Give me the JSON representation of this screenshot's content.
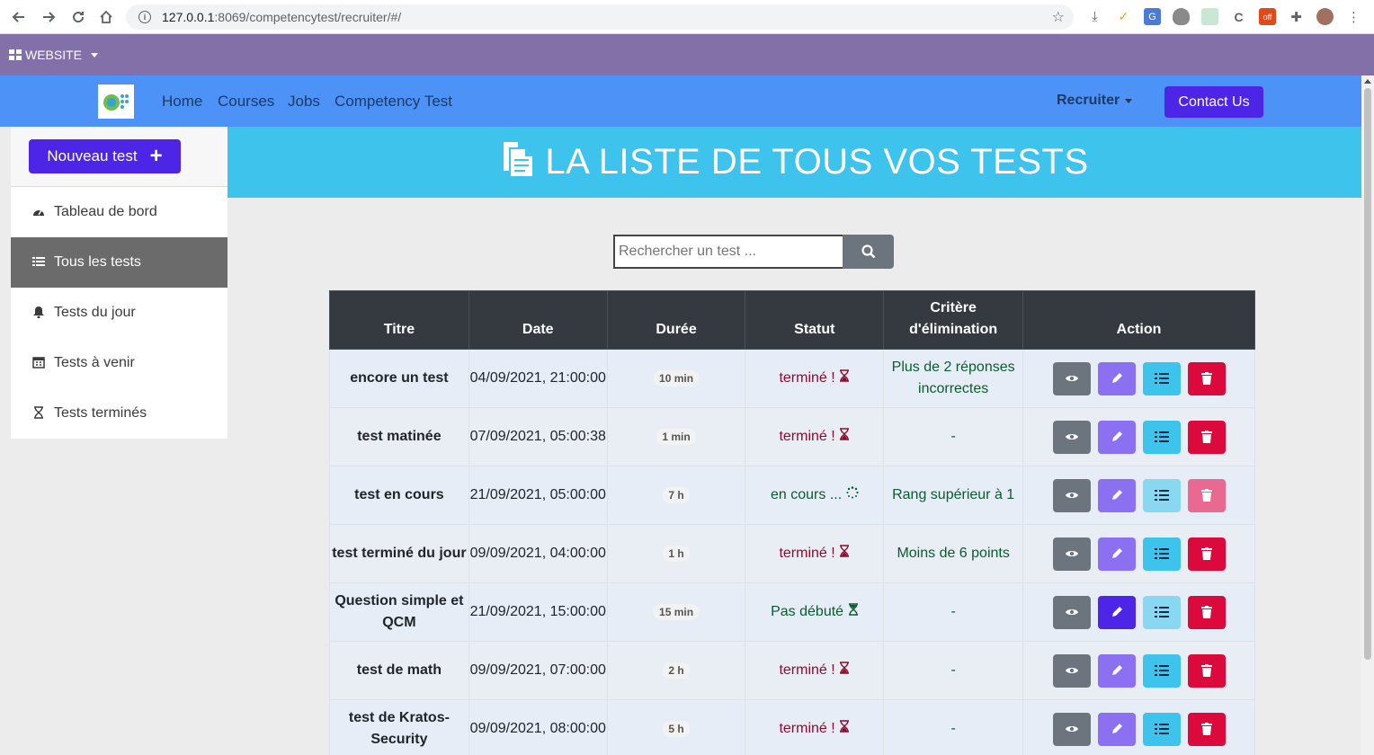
{
  "browser": {
    "url_host": "127.0.0.1",
    "url_path": ":8069/competencytest/recruiter/#/"
  },
  "odoo_bar": {
    "website_label": "WEBSITE"
  },
  "navbar": {
    "links": [
      "Home",
      "Courses",
      "Jobs",
      "Competency Test"
    ],
    "recruiter_label": "Recruiter",
    "contact_label": "Contact Us"
  },
  "sidebar": {
    "new_test_label": "Nouveau test",
    "items": [
      {
        "label": "Tableau de bord",
        "icon": "dashboard-icon"
      },
      {
        "label": "Tous les tests",
        "icon": "list-icon"
      },
      {
        "label": "Tests du jour",
        "icon": "bell-icon"
      },
      {
        "label": "Tests à venir",
        "icon": "calendar-icon"
      },
      {
        "label": "Tests terminés",
        "icon": "hourglass-icon"
      }
    ]
  },
  "banner": {
    "title": "LA LISTE DE TOUS VOS TESTS"
  },
  "search": {
    "placeholder": "Rechercher un test ..."
  },
  "table": {
    "headers": {
      "title": "Titre",
      "date": "Date",
      "duration": "Durée",
      "status": "Statut",
      "criteria": "Critère d'élimination",
      "action": "Action"
    },
    "rows": [
      {
        "title": "encore un test",
        "date": "04/09/2021, 21:00:00",
        "duration": "10 min",
        "status": "terminé !",
        "criteria": "Plus de 2 réponses incorrectes"
      },
      {
        "title": "test matinée",
        "date": "07/09/2021, 05:00:38",
        "duration": "1 min",
        "status": "terminé !",
        "criteria": "-"
      },
      {
        "title": "test en cours",
        "date": "21/09/2021, 05:00:00",
        "duration": "7 h",
        "status": "en cours ...",
        "criteria": "Rang supérieur à 1"
      },
      {
        "title": "test terminé du jour",
        "date": "09/09/2021, 04:00:00",
        "duration": "1 h",
        "status": "terminé !",
        "criteria": "Moins de 6 points"
      },
      {
        "title": "Question simple et QCM",
        "date": "21/09/2021, 15:00:00",
        "duration": "15 min",
        "status": "Pas débuté",
        "criteria": "-"
      },
      {
        "title": "test de math",
        "date": "09/09/2021, 07:00:00",
        "duration": "2 h",
        "status": "terminé !",
        "criteria": "-"
      },
      {
        "title": "test de Kratos-Security",
        "date": "09/09/2021, 08:00:00",
        "duration": "5 h",
        "status": "terminé !",
        "criteria": "-"
      }
    ]
  },
  "colors": {
    "odoo_bar": "#8370a8",
    "navbar": "#4d93f7",
    "primary": "#4c25e6",
    "banner": "#3ec3ec",
    "danger": "#dc0a3c"
  }
}
